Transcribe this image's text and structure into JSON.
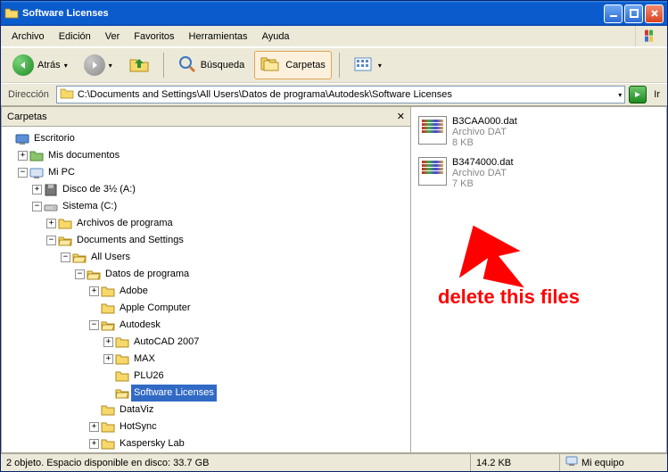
{
  "window": {
    "title": "Software Licenses"
  },
  "menu": {
    "archivo": "Archivo",
    "edicion": "Edición",
    "ver": "Ver",
    "favoritos": "Favoritos",
    "herramientas": "Herramientas",
    "ayuda": "Ayuda"
  },
  "toolbar": {
    "back": "Atrás",
    "search": "Búsqueda",
    "folders": "Carpetas"
  },
  "address": {
    "label": "Dirección",
    "path": "C:\\Documents and Settings\\All Users\\Datos de programa\\Autodesk\\Software Licenses",
    "go": "Ir"
  },
  "treepanel": {
    "header": "Carpetas",
    "nodes": {
      "desktop": "Escritorio",
      "mydocs": "Mis documentos",
      "mypc": "Mi PC",
      "floppy": "Disco de 3½ (A:)",
      "sysc": "Sistema (C:)",
      "archprog": "Archivos de programa",
      "docsettings": "Documents and Settings",
      "allusers": "All Users",
      "datosprog": "Datos de programa",
      "adobe": "Adobe",
      "applecomp": "Apple Computer",
      "autodesk": "Autodesk",
      "autocad": "AutoCAD 2007",
      "max": "MAX",
      "plu26": "PLU26",
      "swlicenses": "Software Licenses",
      "dataviz": "DataViz",
      "hotsync": "HotSync",
      "kaspersky": "Kaspersky Lab"
    }
  },
  "files": [
    {
      "name": "B3CAA000.dat",
      "type": "Archivo DAT",
      "size": "8 KB"
    },
    {
      "name": "B3474000.dat",
      "type": "Archivo DAT",
      "size": "7 KB"
    }
  ],
  "status": {
    "objects": "2 objeto. Espacio disponible en disco:  33.7 GB",
    "selsize": "14.2 KB",
    "location": "Mi equipo"
  },
  "annotation": {
    "text": "delete this files"
  }
}
